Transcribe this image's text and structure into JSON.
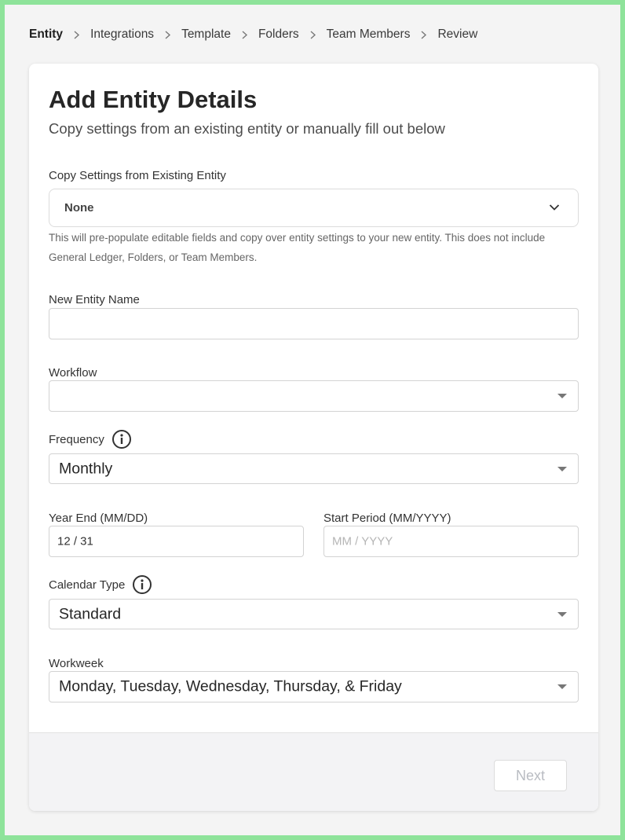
{
  "breadcrumb": {
    "items": [
      "Entity",
      "Integrations",
      "Template",
      "Folders",
      "Team Members",
      "Review"
    ],
    "active_index": 0
  },
  "header": {
    "title": "Add Entity Details",
    "subtitle": "Copy settings from an existing entity or manually fill out below"
  },
  "copy_settings": {
    "label": "Copy Settings from Existing Entity",
    "value": "None",
    "helper": "This will pre-populate editable fields and copy over entity settings to your new entity. This does not include General Ledger, Folders, or Team Members."
  },
  "entity_name": {
    "label": "New Entity Name",
    "value": ""
  },
  "workflow": {
    "label": "Workflow",
    "value": ""
  },
  "frequency": {
    "label": "Frequency",
    "value": "Monthly"
  },
  "year_end": {
    "label": "Year End (MM/DD)",
    "value": "12 / 31"
  },
  "start_period": {
    "label": "Start Period (MM/YYYY)",
    "placeholder": "MM / YYYY"
  },
  "calendar_type": {
    "label": "Calendar Type",
    "value": "Standard"
  },
  "workweek": {
    "label": "Workweek",
    "value": "Monday, Tuesday, Wednesday, Thursday, & Friday"
  },
  "footer": {
    "next_label": "Next",
    "next_disabled": true
  },
  "icons": {
    "separator": "chevron-right-icon",
    "info": "info-icon",
    "dropdown": "chevron-down-icon"
  },
  "colors": {
    "border_accent": "#8ee39a",
    "page_bg": "#f4f4f4",
    "footer_bg": "#f3f3f5"
  }
}
